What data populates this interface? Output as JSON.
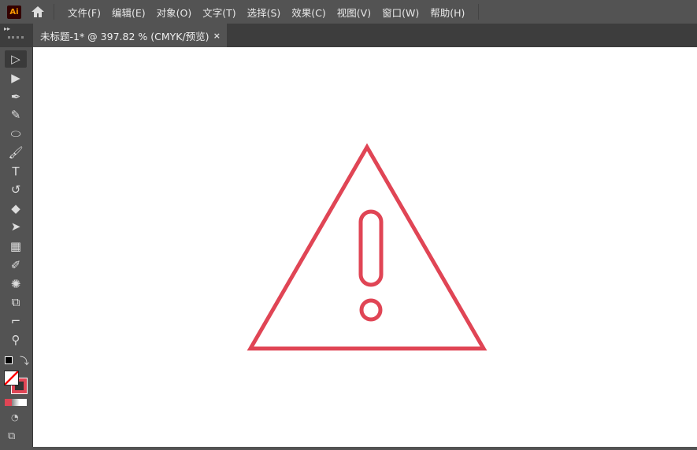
{
  "app": {
    "logo": "Ai",
    "home_icon": "home-icon"
  },
  "menu": [
    "文件(F)",
    "编辑(E)",
    "对象(O)",
    "文字(T)",
    "选择(S)",
    "效果(C)",
    "视图(V)",
    "窗口(W)",
    "帮助(H)"
  ],
  "tab": {
    "title": "未标题-1* @ 397.82 % (CMYK/预览)",
    "close": "×"
  },
  "panel": {
    "collapse": "▸▸"
  },
  "artwork": {
    "stroke_color": "#e04555",
    "shape": "warning-triangle"
  },
  "tools": [
    {
      "name": "selection-tool",
      "glyph": "▷"
    },
    {
      "name": "direct-selection-tool",
      "glyph": "▶"
    },
    {
      "name": "pen-tool",
      "glyph": "✒"
    },
    {
      "name": "curvature-tool",
      "glyph": "✎"
    },
    {
      "name": "ellipse-tool",
      "glyph": "⬭"
    },
    {
      "name": "paintbrush-tool",
      "glyph": "🖌"
    },
    {
      "name": "type-tool",
      "glyph": "T"
    },
    {
      "name": "rotate-tool",
      "glyph": "↺"
    },
    {
      "name": "eraser-tool",
      "glyph": "◆"
    },
    {
      "name": "lasso-tool",
      "glyph": "➤"
    },
    {
      "name": "gradient-tool",
      "glyph": "▦"
    },
    {
      "name": "eyedropper-tool",
      "glyph": "✐"
    },
    {
      "name": "puppet-warp-tool",
      "glyph": "✺"
    },
    {
      "name": "shape-builder-tool",
      "glyph": "⧉"
    },
    {
      "name": "artboard-tool",
      "glyph": "⌐"
    },
    {
      "name": "zoom-tool",
      "glyph": "⚲"
    }
  ]
}
